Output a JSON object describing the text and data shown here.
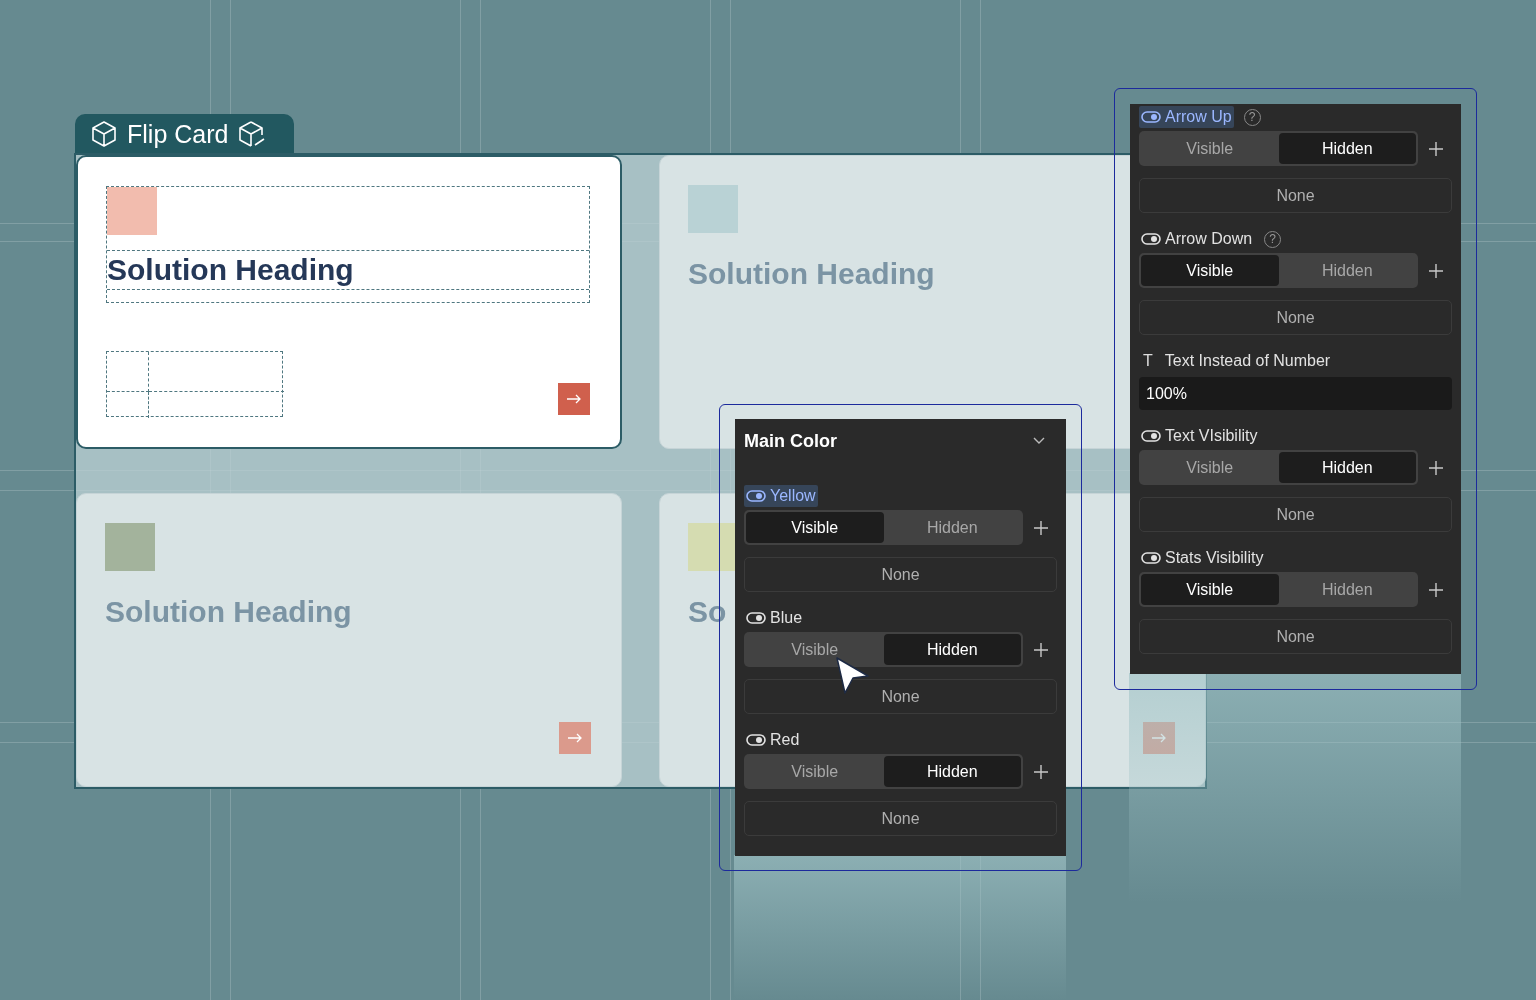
{
  "component_tab": {
    "title": "Flip Card"
  },
  "cards": [
    {
      "heading": "Solution Heading",
      "color": "#f2bcae",
      "active": true,
      "arrow_button": true
    },
    {
      "heading": "Solution Heading",
      "color": "#b9d2d5",
      "active": false,
      "arrow_button": false
    },
    {
      "heading": "Solution Heading",
      "color": "#a3b39c",
      "active": false,
      "arrow_button": true
    },
    {
      "heading": "So",
      "color": "#d5dcb1",
      "active": false,
      "arrow_button": true
    }
  ],
  "main_color_panel": {
    "title": "Main Color",
    "properties": [
      {
        "kind": "toggle",
        "label": "Yellow",
        "highlighted": true,
        "options": [
          {
            "label": "Visible",
            "selected": true
          },
          {
            "label": "Hidden",
            "selected": false
          }
        ],
        "binding": "None"
      },
      {
        "kind": "toggle",
        "label": "Blue",
        "highlighted": false,
        "options": [
          {
            "label": "Visible",
            "selected": false
          },
          {
            "label": "Hidden",
            "selected": true
          }
        ],
        "binding": "None"
      },
      {
        "kind": "toggle",
        "label": "Red",
        "highlighted": false,
        "options": [
          {
            "label": "Visible",
            "selected": false
          },
          {
            "label": "Hidden",
            "selected": true
          }
        ],
        "binding": "None"
      }
    ]
  },
  "properties_panel": {
    "properties": [
      {
        "kind": "toggle",
        "label": "Arrow Up",
        "highlighted": true,
        "help": "?",
        "options": [
          {
            "label": "Visible",
            "selected": false
          },
          {
            "label": "Hidden",
            "selected": true
          }
        ],
        "binding": "None"
      },
      {
        "kind": "toggle",
        "label": "Arrow Down",
        "highlighted": false,
        "help": "?",
        "options": [
          {
            "label": "Visible",
            "selected": true
          },
          {
            "label": "Hidden",
            "selected": false
          }
        ],
        "binding": "None"
      },
      {
        "kind": "text",
        "type_mark": "T",
        "label": "Text Instead of Number",
        "value": "100%"
      },
      {
        "kind": "toggle",
        "label": "Text VIsibility",
        "highlighted": false,
        "options": [
          {
            "label": "Visible",
            "selected": false
          },
          {
            "label": "Hidden",
            "selected": true
          }
        ],
        "binding": "None"
      },
      {
        "kind": "toggle",
        "label": "Stats Visibility",
        "highlighted": false,
        "options": [
          {
            "label": "Visible",
            "selected": true
          },
          {
            "label": "Hidden",
            "selected": false
          }
        ],
        "binding": "None"
      }
    ]
  }
}
